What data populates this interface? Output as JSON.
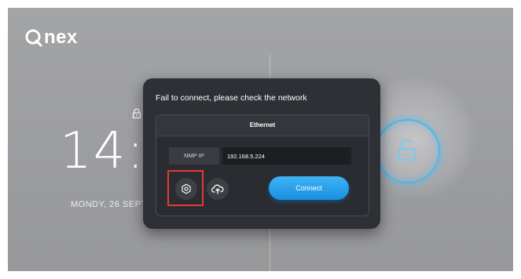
{
  "brand": {
    "logo_text": "nex"
  },
  "lockscreen": {
    "time": "14:",
    "date": "MONDY, 26 SEPT"
  },
  "dialog": {
    "title": "Fail to connect, please check the network",
    "panel_title": "Ethernet",
    "nmp_label": "NMP IP",
    "nmp_value": "192.168.5.224",
    "connect_label": "Connect"
  },
  "icons": {
    "settings": "gear-icon",
    "upload": "cloud-upload-icon",
    "lock": "lock-icon",
    "unlock": "unlock-icon"
  },
  "colors": {
    "accent": "#1a8fe0",
    "highlight": "#e53935",
    "dialog_bg": "#2e3036"
  }
}
